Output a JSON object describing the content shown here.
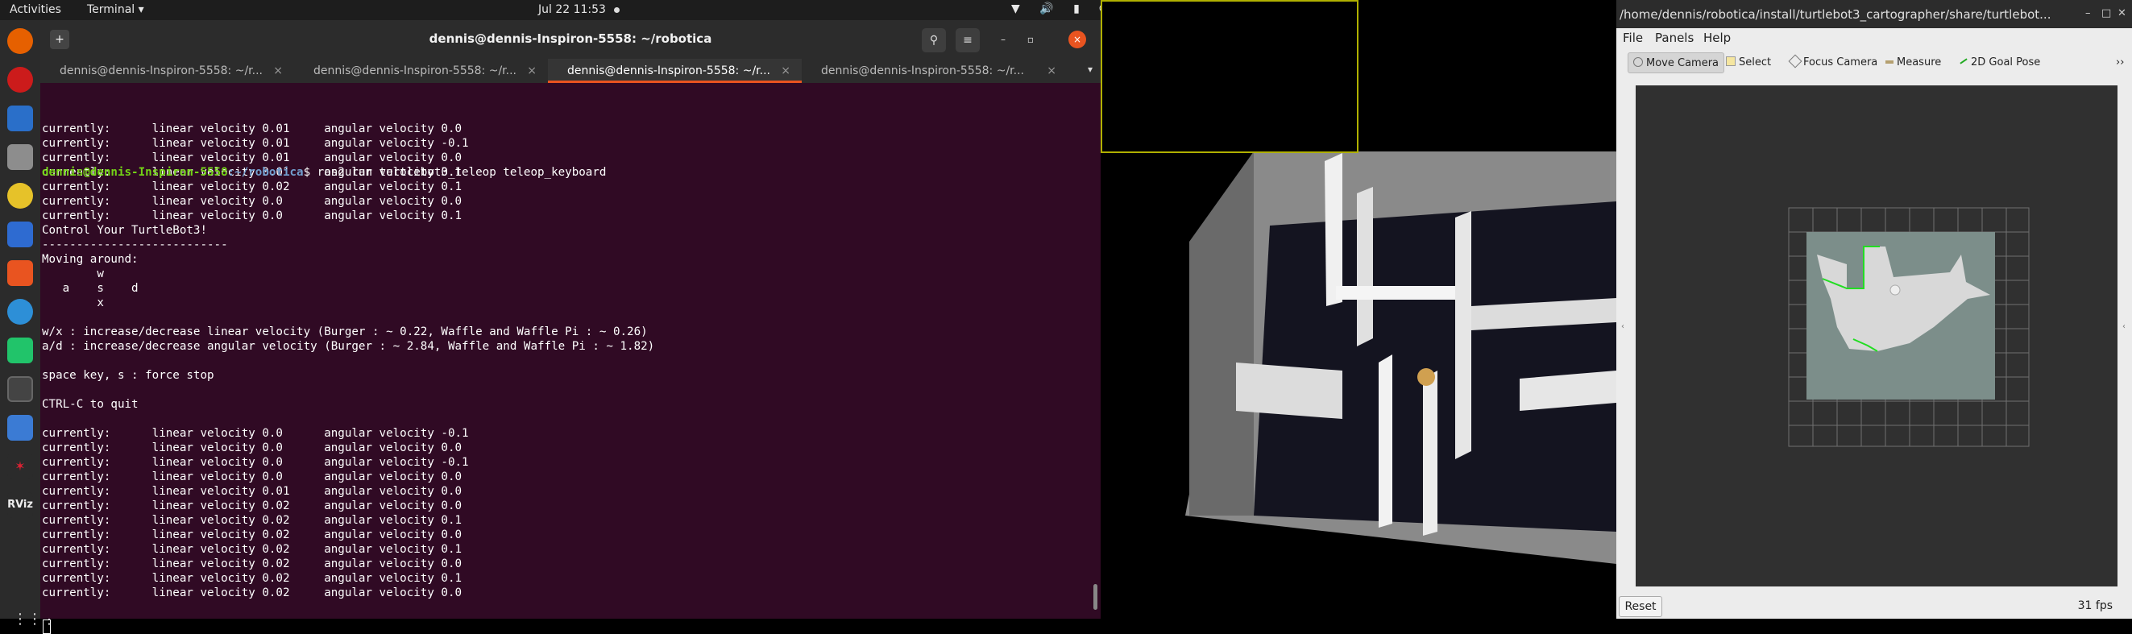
{
  "topbar": {
    "activities": "Activities",
    "app": "Terminal ▾",
    "clock": "Jul 22  11:53",
    "tray": "▼ 🔊 ▮ ⏻ ▾"
  },
  "terminal": {
    "title": "dennis@dennis-Inspiron-5558: ~/robotica",
    "new_tab_icon": "+",
    "search_icon": "⚲",
    "menu_icon": "≡",
    "minimize_icon": "–",
    "maximize_icon": "▫",
    "close_icon": "×",
    "tabs": [
      {
        "label": "dennis@dennis-Inspiron-5558: ~/r...",
        "close": "×"
      },
      {
        "label": "dennis@dennis-Inspiron-5558: ~/r...",
        "close": "×"
      },
      {
        "label": "dennis@dennis-Inspiron-5558: ~/r...",
        "close": "×"
      },
      {
        "label": "dennis@dennis-Inspiron-5558: ~/r...",
        "close": "×"
      }
    ],
    "tabs_more": "▾",
    "prompt_user": "dennis@dennis-Inspiron-5558",
    "prompt_path": ":~/robotica",
    "prompt_cmd": "$ ros2 run turtlebot3_teleop teleop_keyboard",
    "lines_before": [
      "currently:      linear velocity 0.01     angular velocity 0.0",
      "currently:      linear velocity 0.01     angular velocity -0.1",
      "currently:      linear velocity 0.01     angular velocity 0.0",
      "currently:      linear velocity 0.01     angular velocity 0.1",
      "currently:      linear velocity 0.02     angular velocity 0.1",
      "currently:      linear velocity 0.0      angular velocity 0.0",
      "currently:      linear velocity 0.0      angular velocity 0.1"
    ],
    "lines_after": [
      "",
      "Control Your TurtleBot3!",
      "---------------------------",
      "Moving around:",
      "        w",
      "   a    s    d",
      "        x",
      "",
      "w/x : increase/decrease linear velocity (Burger : ~ 0.22, Waffle and Waffle Pi : ~ 0.26)",
      "a/d : increase/decrease angular velocity (Burger : ~ 2.84, Waffle and Waffle Pi : ~ 1.82)",
      "",
      "space key, s : force stop",
      "",
      "CTRL-C to quit",
      "",
      "currently:      linear velocity 0.0      angular velocity -0.1",
      "currently:      linear velocity 0.0      angular velocity 0.0",
      "currently:      linear velocity 0.0      angular velocity -0.1",
      "currently:      linear velocity 0.0      angular velocity 0.0",
      "currently:      linear velocity 0.01     angular velocity 0.0",
      "currently:      linear velocity 0.02     angular velocity 0.0",
      "currently:      linear velocity 0.02     angular velocity 0.1",
      "currently:      linear velocity 0.02     angular velocity 0.0",
      "currently:      linear velocity 0.02     angular velocity 0.1",
      "currently:      linear velocity 0.02     angular velocity 0.0",
      "currently:      linear velocity 0.02     angular velocity 0.1",
      "currently:      linear velocity 0.02     angular velocity 0.0"
    ]
  },
  "rviz": {
    "title": "/home/dennis/robotica/install/turtlebot3_cartographer/share/turtlebot...",
    "win_min": "–",
    "win_max": "□",
    "win_close": "✕",
    "menu": [
      "File",
      "Panels",
      "Help"
    ],
    "tools": [
      "Move Camera",
      "Select",
      "Focus Camera",
      "Measure",
      "2D Goal Pose"
    ],
    "toolbar_more": "››",
    "reset": "Reset",
    "fps": "31 fps",
    "left_handle": "‹",
    "right_handle": "‹"
  },
  "colors": {
    "terminal_bg": "#300a24",
    "accent": "#e95420",
    "prompt_user": "#73d216",
    "prompt_path": "#729fcf"
  },
  "icons": {
    "dock": [
      "firefox-icon",
      "opera-icon",
      "steam-icon",
      "files-icon",
      "rhythmbox-icon",
      "writer-icon",
      "software-icon",
      "help-icon",
      "pycharm-icon",
      "terminal-icon",
      "text-editor-icon",
      "ros-icon",
      "rviz-icon",
      "apps-grid-icon"
    ]
  }
}
